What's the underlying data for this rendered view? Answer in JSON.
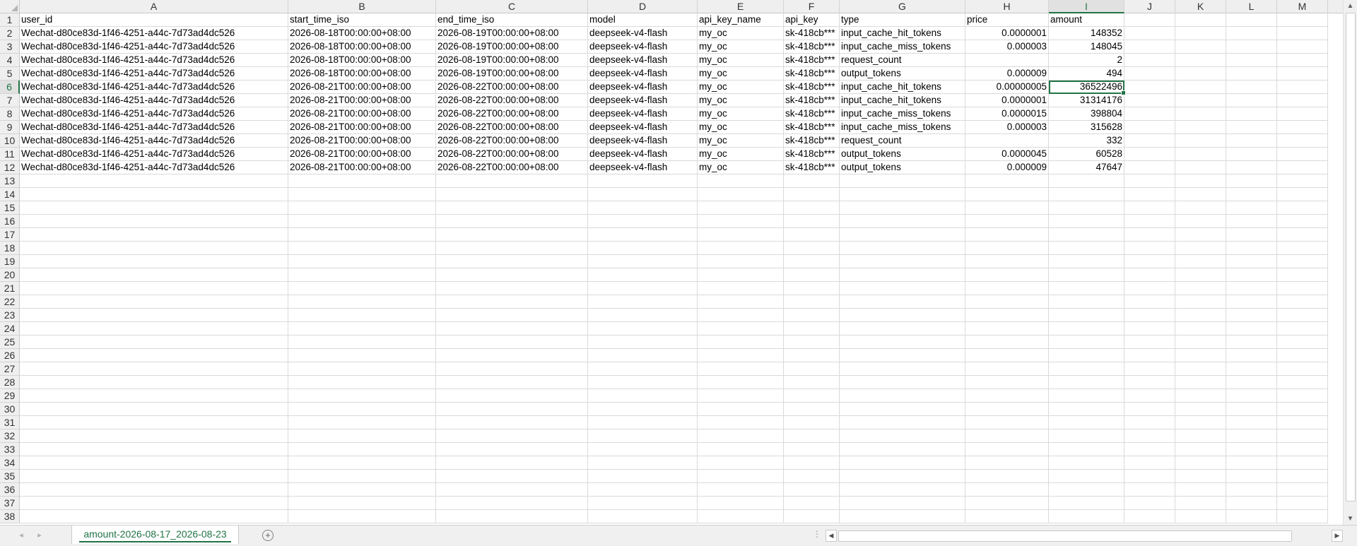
{
  "sheet": {
    "columns": [
      "A",
      "B",
      "C",
      "D",
      "E",
      "F",
      "G",
      "H",
      "I",
      "J",
      "K",
      "L",
      "M"
    ],
    "active_column": "I",
    "active_row": 6,
    "row_count": 38,
    "header_row": [
      "user_id",
      "start_time_iso",
      "end_time_iso",
      "model",
      "api_key_name",
      "api_key",
      "type",
      "price",
      "amount"
    ],
    "rows": [
      [
        "Wechat-d80ce83d-1f46-4251-a44c-7d73ad4dc526",
        "2026-08-18T00:00:00+08:00",
        "2026-08-19T00:00:00+08:00",
        "deepseek-v4-flash",
        "my_oc",
        "sk-418cb***",
        "input_cache_hit_tokens",
        "0.0000001",
        "148352"
      ],
      [
        "Wechat-d80ce83d-1f46-4251-a44c-7d73ad4dc526",
        "2026-08-18T00:00:00+08:00",
        "2026-08-19T00:00:00+08:00",
        "deepseek-v4-flash",
        "my_oc",
        "sk-418cb***",
        "input_cache_miss_tokens",
        "0.000003",
        "148045"
      ],
      [
        "Wechat-d80ce83d-1f46-4251-a44c-7d73ad4dc526",
        "2026-08-18T00:00:00+08:00",
        "2026-08-19T00:00:00+08:00",
        "deepseek-v4-flash",
        "my_oc",
        "sk-418cb***",
        "request_count",
        "",
        "2"
      ],
      [
        "Wechat-d80ce83d-1f46-4251-a44c-7d73ad4dc526",
        "2026-08-18T00:00:00+08:00",
        "2026-08-19T00:00:00+08:00",
        "deepseek-v4-flash",
        "my_oc",
        "sk-418cb***",
        "output_tokens",
        "0.000009",
        "494"
      ],
      [
        "Wechat-d80ce83d-1f46-4251-a44c-7d73ad4dc526",
        "2026-08-21T00:00:00+08:00",
        "2026-08-22T00:00:00+08:00",
        "deepseek-v4-flash",
        "my_oc",
        "sk-418cb***",
        "input_cache_hit_tokens",
        "0.00000005",
        "36522496"
      ],
      [
        "Wechat-d80ce83d-1f46-4251-a44c-7d73ad4dc526",
        "2026-08-21T00:00:00+08:00",
        "2026-08-22T00:00:00+08:00",
        "deepseek-v4-flash",
        "my_oc",
        "sk-418cb***",
        "input_cache_hit_tokens",
        "0.0000001",
        "31314176"
      ],
      [
        "Wechat-d80ce83d-1f46-4251-a44c-7d73ad4dc526",
        "2026-08-21T00:00:00+08:00",
        "2026-08-22T00:00:00+08:00",
        "deepseek-v4-flash",
        "my_oc",
        "sk-418cb***",
        "input_cache_miss_tokens",
        "0.0000015",
        "398804"
      ],
      [
        "Wechat-d80ce83d-1f46-4251-a44c-7d73ad4dc526",
        "2026-08-21T00:00:00+08:00",
        "2026-08-22T00:00:00+08:00",
        "deepseek-v4-flash",
        "my_oc",
        "sk-418cb***",
        "input_cache_miss_tokens",
        "0.000003",
        "315628"
      ],
      [
        "Wechat-d80ce83d-1f46-4251-a44c-7d73ad4dc526",
        "2026-08-21T00:00:00+08:00",
        "2026-08-22T00:00:00+08:00",
        "deepseek-v4-flash",
        "my_oc",
        "sk-418cb***",
        "request_count",
        "",
        "332"
      ],
      [
        "Wechat-d80ce83d-1f46-4251-a44c-7d73ad4dc526",
        "2026-08-21T00:00:00+08:00",
        "2026-08-22T00:00:00+08:00",
        "deepseek-v4-flash",
        "my_oc",
        "sk-418cb***",
        "output_tokens",
        "0.0000045",
        "60528"
      ],
      [
        "Wechat-d80ce83d-1f46-4251-a44c-7d73ad4dc526",
        "2026-08-21T00:00:00+08:00",
        "2026-08-22T00:00:00+08:00",
        "deepseek-v4-flash",
        "my_oc",
        "sk-418cb***",
        "output_tokens",
        "0.000009",
        "47647"
      ]
    ]
  },
  "tabs": {
    "active_sheet": "amount-2026-08-17_2026-08-23",
    "add_sheet_icon": "plus-circle-icon"
  },
  "icons": {
    "nav_prev": "◂",
    "nav_next": "▸",
    "scroll_up": "▲",
    "scroll_down": "▼",
    "scroll_left": "◀",
    "scroll_right": "▶",
    "dots": "⋮"
  },
  "colors": {
    "accent": "#217346"
  }
}
